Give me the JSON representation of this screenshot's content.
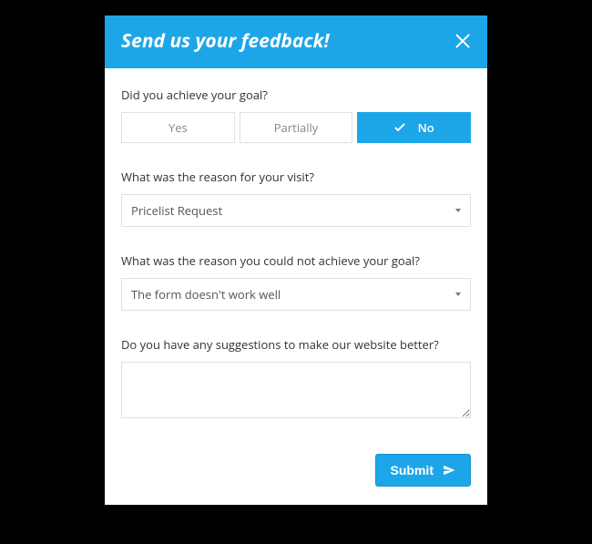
{
  "header": {
    "title": "Send us your feedback!"
  },
  "q1": {
    "label": "Did you achieve your goal?",
    "options": {
      "yes": "Yes",
      "partially": "Partially",
      "no": "No"
    },
    "selected": "no"
  },
  "q2": {
    "label": "What was the reason for your visit?",
    "value": "Pricelist Request"
  },
  "q3": {
    "label": "What was the reason you could not achieve your goal?",
    "value": "The form doesn't work well"
  },
  "q4": {
    "label": "Do you have any suggestions to make our website better?",
    "value": ""
  },
  "submit": "Submit"
}
